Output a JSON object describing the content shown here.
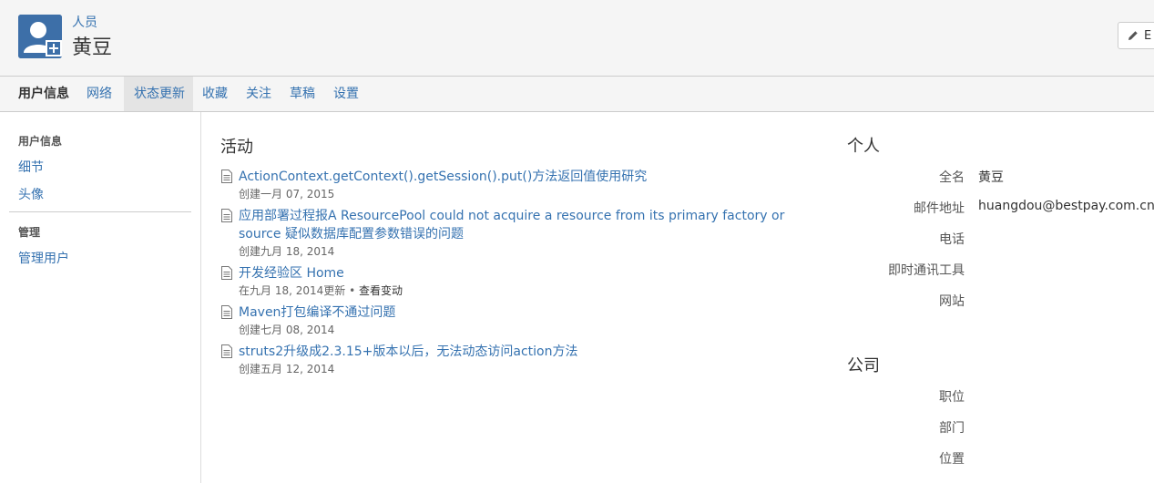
{
  "header": {
    "breadcrumb": "人员",
    "title": "黄豆",
    "edit_label": "E"
  },
  "tabs": [
    {
      "label": "用户信息"
    },
    {
      "label": "网络"
    },
    {
      "label": "状态更新"
    },
    {
      "label": "收藏"
    },
    {
      "label": "关注"
    },
    {
      "label": "草稿"
    },
    {
      "label": "设置"
    }
  ],
  "sidebar": {
    "section1": "用户信息",
    "items1": [
      {
        "label": "细节"
      },
      {
        "label": "头像"
      }
    ],
    "section2": "管理",
    "items2": [
      {
        "label": "管理用户"
      }
    ]
  },
  "activity": {
    "title": "活动",
    "items": [
      {
        "title": "ActionContext.getContext().getSession().put()方法返回值使用研究",
        "meta": "创建一月 07, 2015"
      },
      {
        "title": "应用部署过程报A ResourcePool could not acquire a resource from its primary factory or source 疑似数据库配置参数错误的问题",
        "meta": "创建九月 18, 2014"
      },
      {
        "title": "开发经验区 Home",
        "meta": "在九月 18, 2014更新",
        "meta_sep": " • ",
        "meta_extra": "查看变动"
      },
      {
        "title": "Maven打包编译不通过问题",
        "meta": "创建七月 08, 2014"
      },
      {
        "title": "struts2升级成2.3.15+版本以后，无法动态访问action方法",
        "meta": "创建五月 12, 2014"
      }
    ]
  },
  "personal": {
    "title": "个人",
    "fields": [
      {
        "label": "全名",
        "value": "黄豆"
      },
      {
        "label": "邮件地址",
        "value": "huangdou@bestpay.com.cn"
      },
      {
        "label": "电话",
        "value": ""
      },
      {
        "label": "即时通讯工具",
        "value": ""
      },
      {
        "label": "网站",
        "value": ""
      }
    ]
  },
  "company": {
    "title": "公司",
    "fields": [
      {
        "label": "职位",
        "value": ""
      },
      {
        "label": "部门",
        "value": ""
      },
      {
        "label": "位置",
        "value": ""
      }
    ]
  }
}
